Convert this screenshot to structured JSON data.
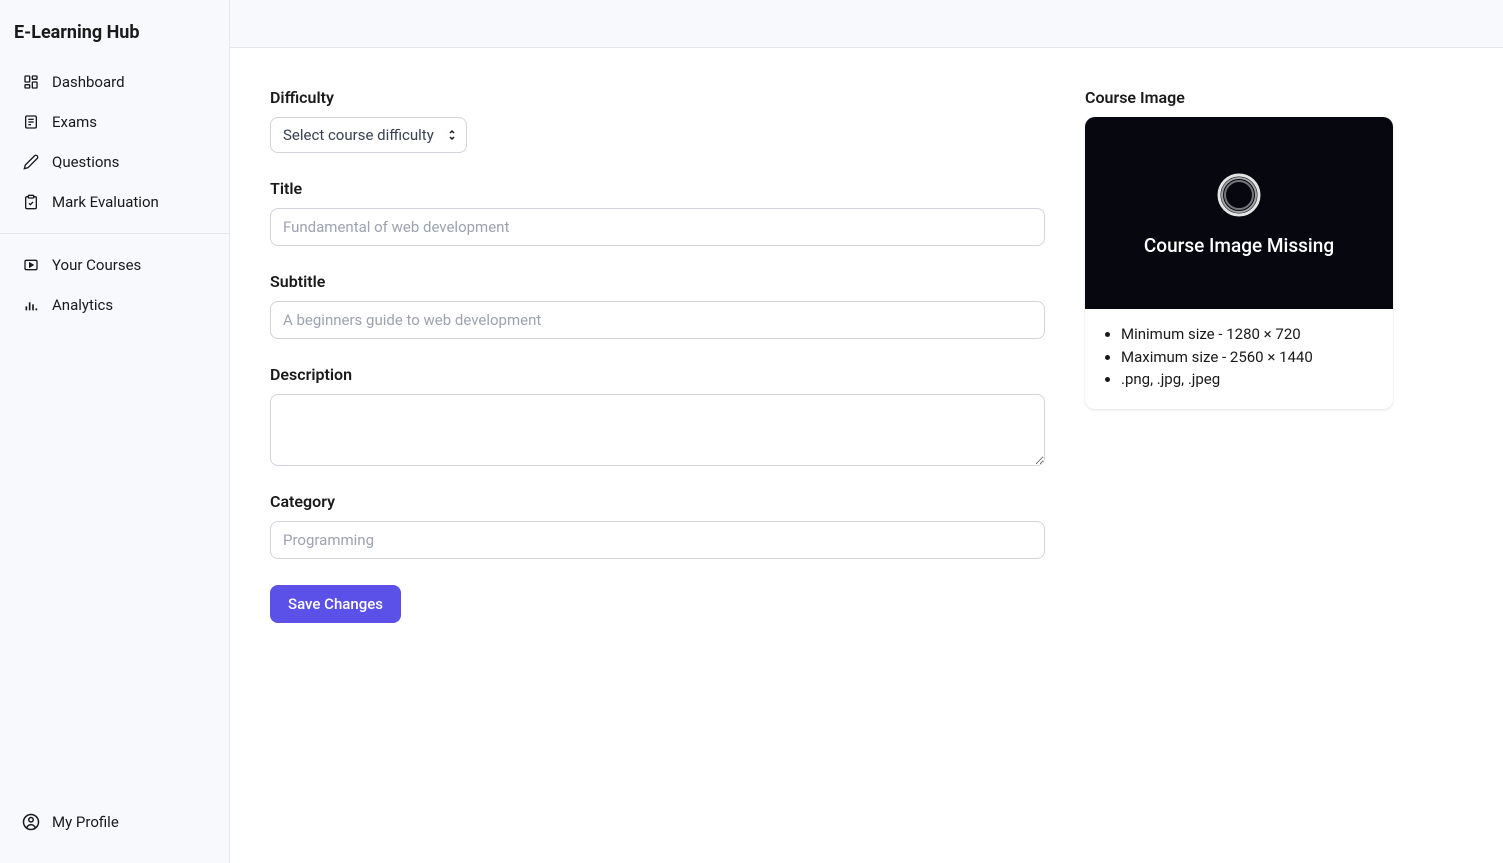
{
  "app": {
    "title": "E-Learning Hub"
  },
  "sidebar": {
    "items": [
      {
        "label": "Dashboard"
      },
      {
        "label": "Exams"
      },
      {
        "label": "Questions"
      },
      {
        "label": "Mark Evaluation"
      }
    ],
    "items2": [
      {
        "label": "Your Courses"
      },
      {
        "label": "Analytics"
      }
    ],
    "profile_label": "My Profile"
  },
  "form": {
    "difficulty": {
      "label": "Difficulty",
      "placeholder": "Select course difficulty"
    },
    "title": {
      "label": "Title",
      "placeholder": "Fundamental of web development",
      "value": ""
    },
    "subtitle": {
      "label": "Subtitle",
      "placeholder": "A beginners guide to web development",
      "value": ""
    },
    "description": {
      "label": "Description",
      "value": ""
    },
    "category": {
      "label": "Category",
      "placeholder": "Programming",
      "value": ""
    },
    "save_label": "Save Changes"
  },
  "image_panel": {
    "heading": "Course Image",
    "missing_text": "Course Image Missing",
    "requirements": [
      "Minimum size - 1280 × 720",
      "Maximum size - 2560 × 1440",
      ".png, .jpg, .jpeg"
    ]
  }
}
